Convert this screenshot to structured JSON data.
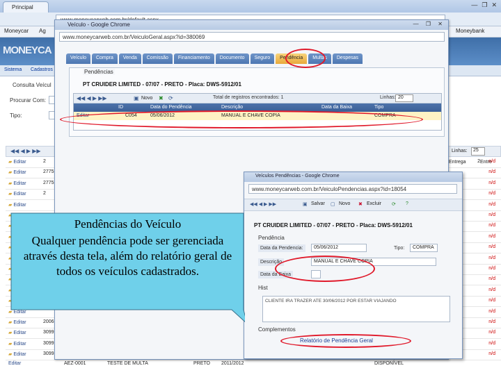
{
  "browser": {
    "tab_title": "Principal",
    "window_controls": [
      "—",
      "❐",
      "✕"
    ],
    "address": "www.moneycarweb.com.br/default.aspx",
    "bookmarks": [
      "Moneycar",
      "Ag",
      "Moneybank"
    ]
  },
  "app": {
    "logo": "MONEYCA",
    "menu": [
      "Sistema",
      "Cadastros"
    ],
    "consulta_title": "Consulta Veícul",
    "filters": {
      "label1": "Procurar Com:",
      "label2": "Tipo:"
    },
    "grid_rows_label": "Linhas:",
    "grid_rows_value": "25",
    "rows": [
      {
        "edit": "Editar",
        "code": "2",
        "right": "2",
        "flag": "n/d"
      },
      {
        "edit": "Editar",
        "code": "27757",
        "right": "",
        "flag": "n/d"
      },
      {
        "edit": "Editar",
        "code": "27757",
        "right": "",
        "flag": "n/d"
      },
      {
        "edit": "Editar",
        "code": "2",
        "right": "",
        "flag": "n/d"
      },
      {
        "edit": "Editar",
        "code": "",
        "right": "",
        "flag": "n/d"
      },
      {
        "edit": "Editar",
        "code": "",
        "right": "",
        "flag": "n/d"
      },
      {
        "edit": "Editar",
        "code": "",
        "right": "",
        "flag": "n/d"
      },
      {
        "edit": "Editar",
        "code": "",
        "right": "",
        "flag": "n/d"
      },
      {
        "edit": "Editar",
        "code": "",
        "right": "",
        "flag": "n/d"
      },
      {
        "edit": "Editar",
        "code": "",
        "right": "",
        "flag": "n/d"
      },
      {
        "edit": "Editar",
        "code": "",
        "right": "",
        "flag": "n/d"
      },
      {
        "edit": "Editar",
        "code": "",
        "right": "",
        "flag": "n/d"
      },
      {
        "edit": "Editar",
        "code": "",
        "right": "",
        "flag": "n/d"
      },
      {
        "edit": "Editar",
        "code": "",
        "right": "",
        "flag": "n/d"
      },
      {
        "edit": "Editar",
        "code": "",
        "right": "",
        "flag": "n/d"
      },
      {
        "edit": "Editar",
        "code": "20065",
        "right": "",
        "flag": "n/d"
      },
      {
        "edit": "Editar",
        "code": "30999",
        "right": "",
        "flag": "n/d"
      },
      {
        "edit": "Editar",
        "code": "30999",
        "right": "",
        "flag": "n/d"
      },
      {
        "edit": "Editar",
        "code": "30999",
        "right": "",
        "flag": "n/d"
      }
    ],
    "bottom_row": {
      "plate": "AEZ-0001",
      "desc": "TESTE DE MULTA",
      "color": "PRETO",
      "year": "2011/2012",
      "status": "DISPONÍVEL"
    },
    "right_col_header": [
      "Entrega",
      "Entre"
    ]
  },
  "window1": {
    "title": "Veículo - Google Chrome",
    "url": "www.moneycarweb.com.br/VeiculoGeral.aspx?id=380069",
    "tabs": [
      "Veículo",
      "Compra",
      "Venda",
      "Comissão",
      "Financiamento",
      "Documento",
      "Seguro",
      "Pendência",
      "Multas",
      "Despesas"
    ],
    "active_tab": "Pendência",
    "panel_legend": "Pendências",
    "vehicle_line": "PT CRUIDER LIMITED - 07/07 - PRETO - Placa: DWS-5912/01",
    "toolbar_new": "Novo",
    "total_label": "Total de registros encontrados: 1",
    "lines_label": "Linhas:",
    "lines_value": "20",
    "headers": [
      "ID",
      "Data do Pendência",
      "Descrição",
      "Data da Baixa",
      "Tipo"
    ],
    "row": {
      "edit": "Editar",
      "id": "C054",
      "date": "05/06/2012",
      "desc": "MANUAL E CHAVE COPIA",
      "baixa": "",
      "type": "COMPRA"
    }
  },
  "window2": {
    "title": "Veículos Pendências - Google Chrome",
    "url": "www.moneycarweb.com.br/VeiculoPendencias.aspx?id=18054",
    "toolbar": [
      "Salvar",
      "Novo",
      "Excluir"
    ],
    "vehicle_line": "PT CRUIDER LIMITED - 07/07 - PRETO - Placa: DWS-5912/01",
    "pend_legend": "Pendência",
    "fields": {
      "date_label": "Data da Pendencia:",
      "date_value": "05/06/2012",
      "type_label": "Tipo:",
      "type_value": "COMPRA",
      "desc_label": "Descrição",
      "desc_value": "MANUAL E CHAVE COPIA",
      "baixa_label": "Data da Baixa",
      "baixa_value": ""
    },
    "hist_legend": "Hist",
    "hist_text": "CLIENTE IRA TRAZER ATE 30/06/2012 POR ESTAR VIAJANDO",
    "comp_legend": "Complementos",
    "report_link": "Relatório de Pendência Geral"
  },
  "callout": {
    "title": "Pendências do Veículo",
    "body": "Qualquer pendência pode ser gerenciada através desta tela, além do relatório geral de todos os veículos cadastrados.",
    "fill": "#6fd0ea"
  }
}
